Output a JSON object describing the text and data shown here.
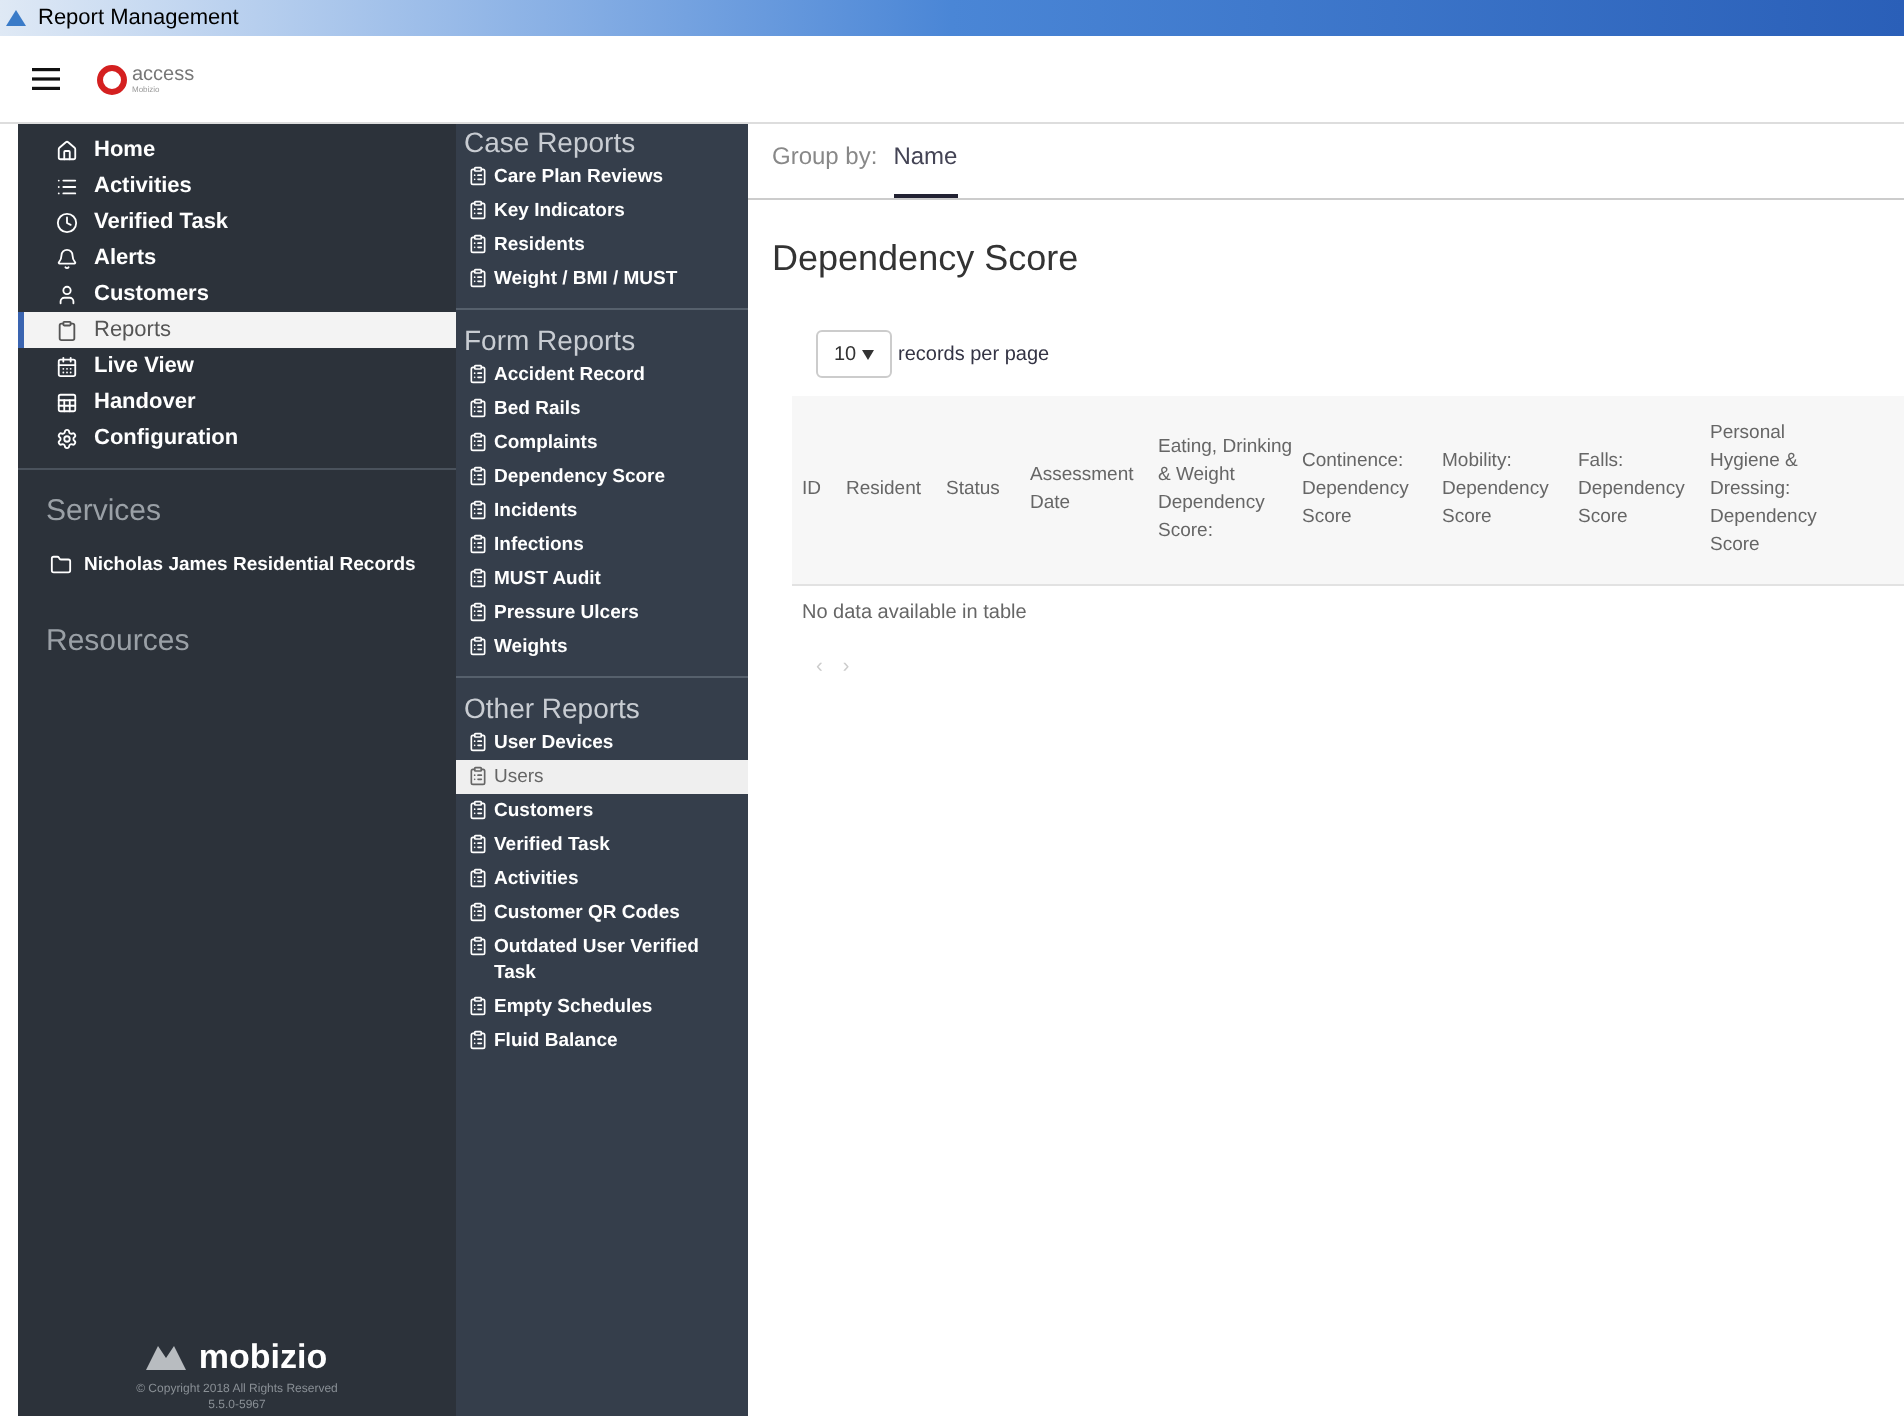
{
  "window": {
    "title": "Report Management"
  },
  "header": {
    "logo_text": "access",
    "logo_subtext": "Mobizio"
  },
  "nav": {
    "items": [
      {
        "label": "Home",
        "selected": false
      },
      {
        "label": "Activities",
        "selected": false
      },
      {
        "label": "Verified Task",
        "selected": false
      },
      {
        "label": "Alerts",
        "selected": false
      },
      {
        "label": "Customers",
        "selected": false
      },
      {
        "label": "Reports",
        "selected": true
      },
      {
        "label": "Live View",
        "selected": false
      },
      {
        "label": "Handover",
        "selected": false
      },
      {
        "label": "Configuration",
        "selected": false
      }
    ],
    "services": {
      "title": "Services",
      "items": [
        {
          "label": "Nicholas James Residential Records"
        }
      ]
    },
    "resources": {
      "title": "Resources"
    },
    "brand": "mobizio",
    "copyright": "© Copyright 2018 All Rights Reserved",
    "version": "5.5.0-5967"
  },
  "report_groups": [
    {
      "title": "Case Reports",
      "items": [
        {
          "label": "Care Plan Reviews",
          "selected": false
        },
        {
          "label": "Key Indicators",
          "selected": false
        },
        {
          "label": "Residents",
          "selected": false
        },
        {
          "label": "Weight / BMI / MUST",
          "selected": false
        }
      ]
    },
    {
      "title": "Form Reports",
      "items": [
        {
          "label": "Accident Record",
          "selected": false
        },
        {
          "label": "Bed Rails",
          "selected": false
        },
        {
          "label": "Complaints",
          "selected": false
        },
        {
          "label": "Dependency Score",
          "selected": false
        },
        {
          "label": "Incidents",
          "selected": false
        },
        {
          "label": "Infections",
          "selected": false
        },
        {
          "label": "MUST Audit",
          "selected": false
        },
        {
          "label": "Pressure Ulcers",
          "selected": false
        },
        {
          "label": "Weights",
          "selected": false
        }
      ]
    },
    {
      "title": "Other Reports",
      "items": [
        {
          "label": "User Devices",
          "selected": false
        },
        {
          "label": "Users",
          "selected": true
        },
        {
          "label": "Customers",
          "selected": false
        },
        {
          "label": "Verified Task",
          "selected": false
        },
        {
          "label": "Activities",
          "selected": false
        },
        {
          "label": "Customer QR Codes",
          "selected": false
        },
        {
          "label": "Outdated User Verified Task",
          "selected": false
        },
        {
          "label": "Empty Schedules",
          "selected": false
        },
        {
          "label": "Fluid Balance",
          "selected": false
        }
      ]
    }
  ],
  "main": {
    "group_by_label": "Group by:",
    "group_tabs": [
      {
        "label": "Name",
        "selected": true
      }
    ],
    "title": "Dependency Score",
    "page_size": "10",
    "page_size_suffix": "records per page",
    "table": {
      "columns": [
        "ID",
        "Resident",
        "Status",
        "Assessment Date",
        "Eating, Drinking & Weight Dependency Score:",
        "Continence: Dependency Score",
        "Mobility: Dependency Score",
        "Falls: Dependency Score",
        "Personal Hygiene & Dressing: Dependency Score"
      ],
      "empty_message": "No data available in table"
    },
    "pager": {
      "prev": "‹",
      "next": "›"
    }
  }
}
